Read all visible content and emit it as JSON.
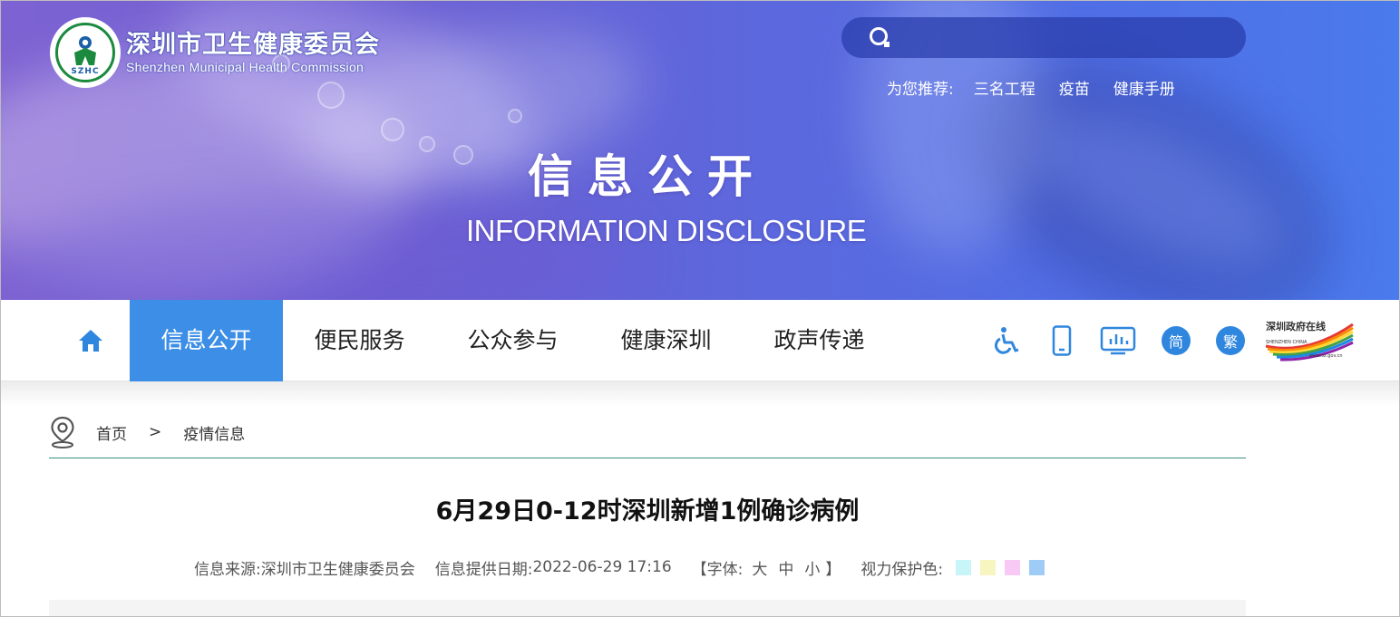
{
  "header": {
    "site_title": "深圳市卫生健康委员会",
    "site_subtitle": "Shenzhen Municipal Health Commission",
    "logo_text": "SZHC",
    "search": {
      "value": "",
      "placeholder": ""
    },
    "recommend_label": "为您推荐:",
    "recommend_links": [
      "三名工程",
      "疫苗",
      "健康手册"
    ]
  },
  "banner": {
    "title": "信息公开",
    "subtitle": "INFORMATION DISCLOSURE"
  },
  "nav": {
    "items": [
      {
        "label": "信息公开",
        "active": true
      },
      {
        "label": "便民服务",
        "active": false
      },
      {
        "label": "公众参与",
        "active": false
      },
      {
        "label": "健康深圳",
        "active": false
      },
      {
        "label": "政声传递",
        "active": false
      }
    ],
    "tools": {
      "simplified_label": "简",
      "traditional_label": "繁",
      "sz_logo_title": "深圳政府在线",
      "sz_logo_sub": "SHENZHEN CHINA",
      "sz_logo_url": "www.sz.gov.cn"
    },
    "accent_color": "#3c8ee6"
  },
  "breadcrumb": {
    "home": "首页",
    "separator": ">",
    "current": "疫情信息"
  },
  "article": {
    "title": "6月29日0-12时深圳新增1例确诊病例",
    "source_label": "信息来源:",
    "source": "深圳市卫生健康委员会",
    "date_label": "信息提供日期:",
    "date": "2022-06-29 17:16",
    "font_open": "【字体:",
    "font_large": "大",
    "font_medium": "中",
    "font_small": "小",
    "font_close": "】",
    "eye_care_label": "视力保护色:",
    "eye_care_colors": [
      "#c8f5f7",
      "#f7f5c0",
      "#f9c9f6",
      "#9fcbf7"
    ]
  }
}
